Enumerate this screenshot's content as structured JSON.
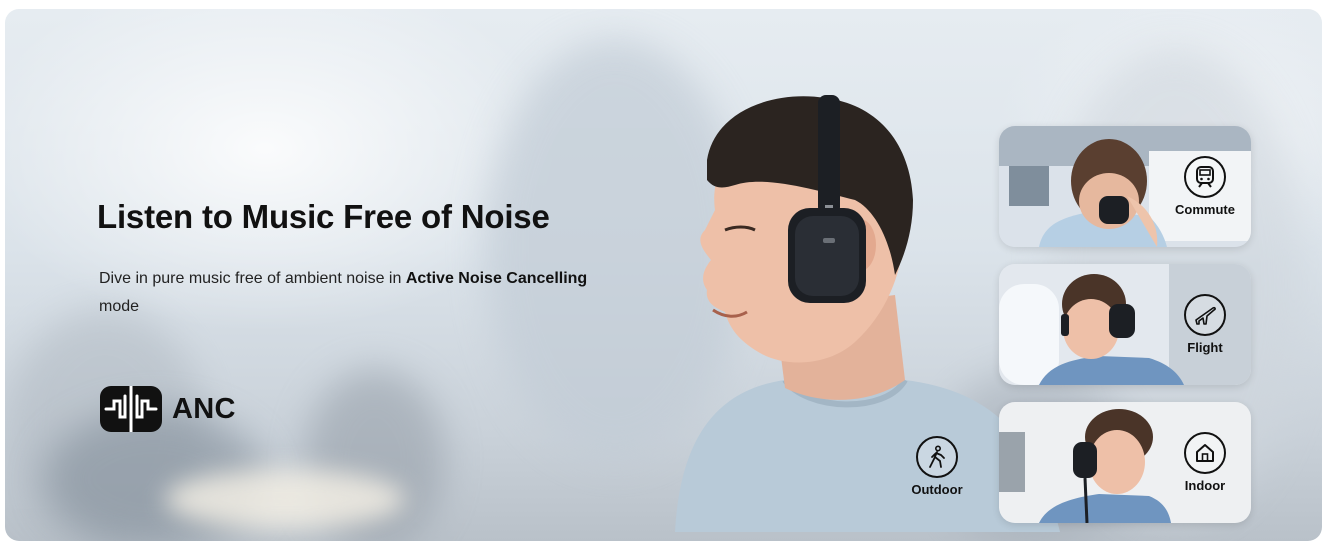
{
  "headline": "Listen to Music Free of Noise",
  "description": {
    "part1": "Dive in pure music free of ambient noise in ",
    "bold1": "Active Noise Cancelling",
    "part2": " mode"
  },
  "anc": {
    "label": "ANC",
    "icon": "anc-waveform-icon"
  },
  "scenarios": [
    {
      "label": "Commute",
      "icon": "train-icon"
    },
    {
      "label": "Flight",
      "icon": "airplane-icon"
    },
    {
      "label": "Indoor",
      "icon": "house-icon"
    },
    {
      "label": "Outdoor",
      "icon": "walking-person-icon"
    }
  ],
  "colors": {
    "text": "#111111",
    "headphone": "#1c1f24"
  }
}
